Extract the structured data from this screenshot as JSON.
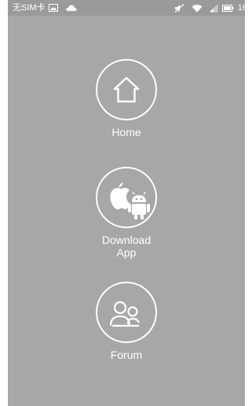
{
  "status_bar": {
    "carrier": "无SIM卡",
    "time": "16:",
    "icons": [
      "image-icon",
      "cloud-icon",
      "mute-icon",
      "wifi-icon",
      "signal-icon",
      "battery-icon"
    ]
  },
  "menu": {
    "items": [
      {
        "label_lines": [
          "Home"
        ],
        "icon": "house-icon"
      },
      {
        "label_lines": [
          "Download",
          "App"
        ],
        "icon": "apple-android-icon"
      },
      {
        "label_lines": [
          "Forum"
        ],
        "icon": "people-icon"
      }
    ]
  },
  "colors": {
    "background": "#a7a7a7",
    "status_bar": "#9a9a9a",
    "foreground": "#ffffff"
  }
}
